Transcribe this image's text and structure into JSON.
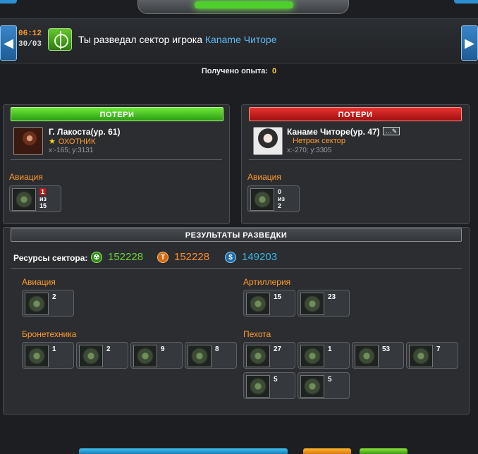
{
  "header": {
    "time": "06:12",
    "date": "30/03",
    "message_prefix": "Ты разведал сектор игрока ",
    "message_player": "Каname Читоре",
    "nav_left": "◀",
    "nav_right": "▶"
  },
  "experience": {
    "label": "Получено опыта:",
    "value": "0"
  },
  "left_player": {
    "losses_label": "ПОТЕРИ",
    "name": "Г. Лакоста(ур. 61)",
    "title": "ОХОТНИК",
    "coords": "x:-165; y:3131",
    "section": "Авиация",
    "unit": {
      "lost": "1",
      "of": "из",
      "total": "15"
    }
  },
  "right_player": {
    "losses_label": "ПОТЕРИ",
    "name": "Канаме Читоре(ур. 47)",
    "title": "Нетрож сектор",
    "coords": "x:-270; y:3305",
    "section": "Авиация",
    "edit": "…✎",
    "unit": {
      "lost": "0",
      "of": "из",
      "total": "2"
    }
  },
  "recon": {
    "title": "РЕЗУЛЬТАТЫ РАЗВЕДКИ",
    "resources_label": "Ресурсы сектора:",
    "resources": [
      {
        "icon": "radiation-icon",
        "value": "152228",
        "color": "#6ed232"
      },
      {
        "icon": "titanium-icon",
        "value": "152228",
        "color": "#ff8c2b"
      },
      {
        "icon": "credits-icon",
        "value": "149203",
        "color": "#3fb6e8"
      }
    ],
    "aviation": {
      "label": "Авиация",
      "units": [
        "2"
      ]
    },
    "artillery": {
      "label": "Артиллерия",
      "units": [
        "15",
        "23"
      ]
    },
    "armor": {
      "label": "Бронетехника",
      "units": [
        "1",
        "2",
        "9",
        "8"
      ]
    },
    "infantry": {
      "label": "Пехота",
      "units": [
        "27",
        "1",
        "53",
        "7",
        "5",
        "5"
      ]
    }
  },
  "colors": {
    "accent_orange": "#ff9b2b",
    "player_blue": "#5bb8f5",
    "exp_yellow": "#ffd21c"
  }
}
